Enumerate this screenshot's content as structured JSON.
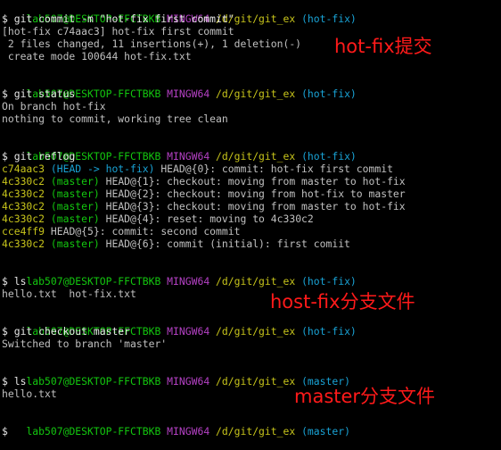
{
  "prompt_user": "lab507@DESKTOP-FFCTBKB",
  "prompt_host": "MINGW64",
  "prompt_path": "/d/git/git_ex",
  "blocks": [
    {
      "branch": "(hot-fix)",
      "cmd": "$ git commit -m \"hot-fix first commit\"",
      "out": [
        "[hot-fix c74aac3] hot-fix first commit",
        " 2 files changed, 11 insertions(+), 1 deletion(-)",
        " create mode 100644 hot-fix.txt"
      ]
    },
    {
      "branch": "(hot-fix)",
      "cmd": "$ git status",
      "out": [
        "On branch hot-fix",
        "nothing to commit, working tree clean"
      ]
    },
    {
      "branch": "(hot-fix)",
      "cmd": "$ git reflog"
    },
    {
      "branch": "(hot-fix)",
      "cmd": "$ ls",
      "out": [
        "hello.txt  hot-fix.txt"
      ]
    },
    {
      "branch": "(hot-fix)",
      "cmd": "$ git checkout master",
      "out": [
        "Switched to branch 'master'"
      ]
    },
    {
      "branch": "(master)",
      "cmd": "$ ls",
      "out": [
        "hello.txt"
      ]
    },
    {
      "branch": "(master)",
      "cmd": "$"
    }
  ],
  "reflog": [
    {
      "hash": "c74aac3",
      "ref": "(HEAD -> hot-fix)",
      "msg": " HEAD@{0}: commit: hot-fix first commit"
    },
    {
      "hash": "4c330c2",
      "ref": "(master)",
      "msg": " HEAD@{1}: checkout: moving from master to hot-fix"
    },
    {
      "hash": "4c330c2",
      "ref": "(master)",
      "msg": " HEAD@{2}: checkout: moving from hot-fix to master"
    },
    {
      "hash": "4c330c2",
      "ref": "(master)",
      "msg": " HEAD@{3}: checkout: moving from master to hot-fix"
    },
    {
      "hash": "4c330c2",
      "ref": "(master)",
      "msg": " HEAD@{4}: reset: moving to 4c330c2"
    },
    {
      "hash": "cce4ff9",
      "ref": "",
      "msg": " HEAD@{5}: commit: second commit"
    },
    {
      "hash": "4c330c2",
      "ref": "(master)",
      "msg": " HEAD@{6}: commit (initial): first comiit"
    }
  ],
  "annotations": {
    "hotfix_commit": "hot-fix提交",
    "hotfix_files": "host-fix分支文件",
    "master_files": "master分支文件"
  },
  "colors": {
    "background": "#000000",
    "user": "#13c70f",
    "host": "#b541c5",
    "path": "#c7c41b",
    "branch": "#19a3d6",
    "annotation": "#ff1a1a"
  }
}
